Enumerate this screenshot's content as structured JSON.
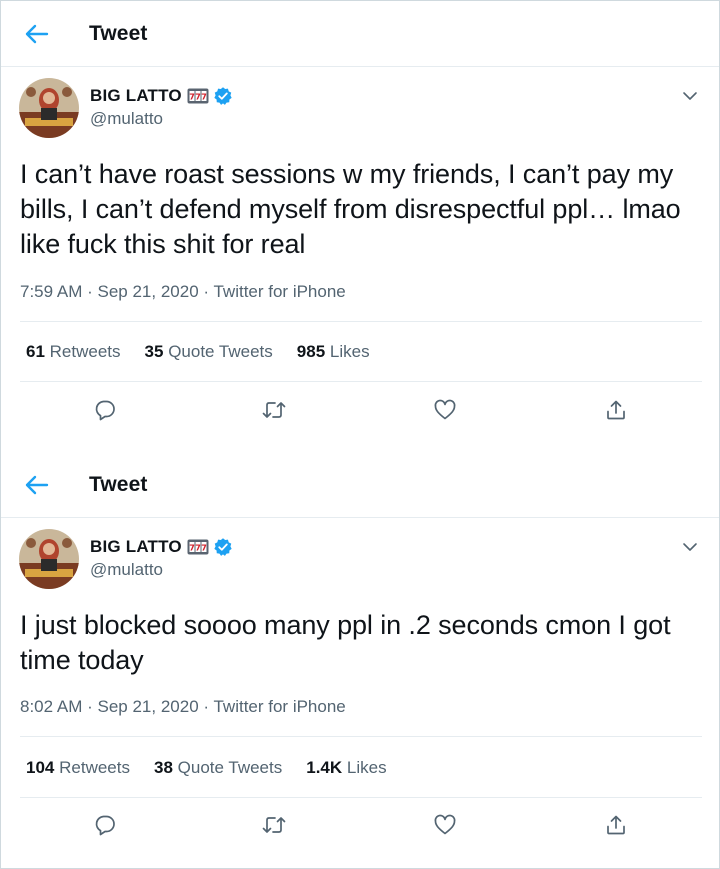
{
  "colors": {
    "accent": "#1da1f2",
    "text": "#0f1419",
    "muted": "#536471",
    "border": "#e6ecf0"
  },
  "tweets": [
    {
      "header_title": "Tweet",
      "author_name": "BIG LATTO",
      "handle": "@mulatto",
      "name_emoji": "slot-machine-icon",
      "text": "I can’t have roast sessions w my friends, I can’t pay my bills, I can’t defend myself from disrespectful ppl… lmao like fuck this shit for real",
      "time": "7:59 AM",
      "date": "Sep 21, 2020",
      "source": "Twitter for iPhone",
      "retweets_count": "61",
      "retweets_label": "Retweets",
      "quotes_count": "35",
      "quotes_label": "Quote Tweets",
      "likes_count": "985",
      "likes_label": "Likes"
    },
    {
      "header_title": "Tweet",
      "author_name": "BIG LATTO",
      "handle": "@mulatto",
      "name_emoji": "slot-machine-icon",
      "text": "I just blocked soooo many ppl in .2 seconds cmon I got time today",
      "time": "8:02 AM",
      "date": "Sep 21, 2020",
      "source": "Twitter for iPhone",
      "retweets_count": "104",
      "retweets_label": "Retweets",
      "quotes_count": "38",
      "quotes_label": "Quote Tweets",
      "likes_count": "1.4K",
      "likes_label": "Likes"
    }
  ]
}
